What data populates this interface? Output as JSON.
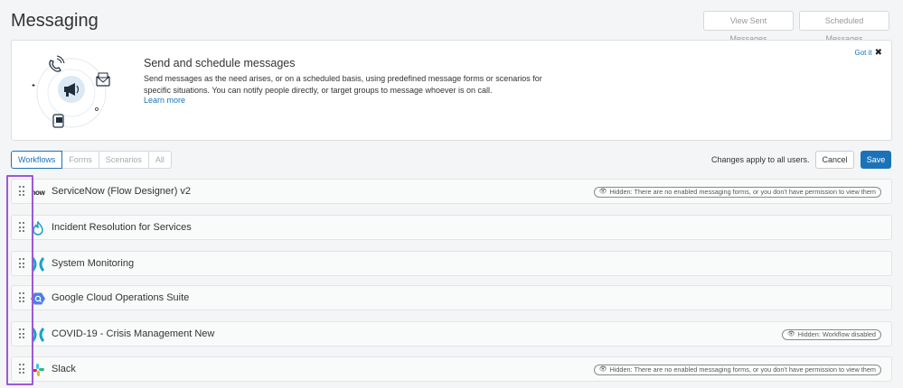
{
  "page": {
    "title": "Messaging",
    "view_sent_label": "View Sent Messages",
    "scheduled_label": "Scheduled Messages"
  },
  "info_card": {
    "title": "Send and schedule messages",
    "body": "Send messages as the need arises, or on a scheduled basis, using predefined message forms or scenarios for specific situations. You can notify people directly, or target groups to message whoever is on call.",
    "link": "Learn more",
    "dismiss_label": "Got it"
  },
  "tabs": [
    "Workflows",
    "Forms",
    "Scenarios",
    "All"
  ],
  "actions": {
    "note": "Changes apply to all users.",
    "cancel_label": "Cancel",
    "save_label": "Save"
  },
  "rows": [
    {
      "name": "ServiceNow (Flow Designer) v2",
      "icon": "servicenow-logo-icon",
      "icon_text": "now",
      "badge": "Hidden: There are no enabled messaging forms, or you don't have permission to view them"
    },
    {
      "name": "Incident Resolution for Services",
      "icon": "flame-icon",
      "badge": ""
    },
    {
      "name": "System Monitoring",
      "icon": "xmatters-x-icon",
      "badge": ""
    },
    {
      "name": "Google Cloud Operations Suite",
      "icon": "google-cloud-hexagon-icon",
      "badge": ""
    },
    {
      "name": "COVID-19 - Crisis Management New",
      "icon": "xmatters-x-icon",
      "badge": "Hidden: Workflow disabled"
    },
    {
      "name": "Slack",
      "icon": "slack-logo-icon",
      "badge": "Hidden: There are no enabled messaging forms, or you don't have permission to view them"
    }
  ],
  "colors": {
    "accent": "#1a73b8",
    "selection": "#9b59d6",
    "xmatters_teal": "#1aa3c8"
  }
}
